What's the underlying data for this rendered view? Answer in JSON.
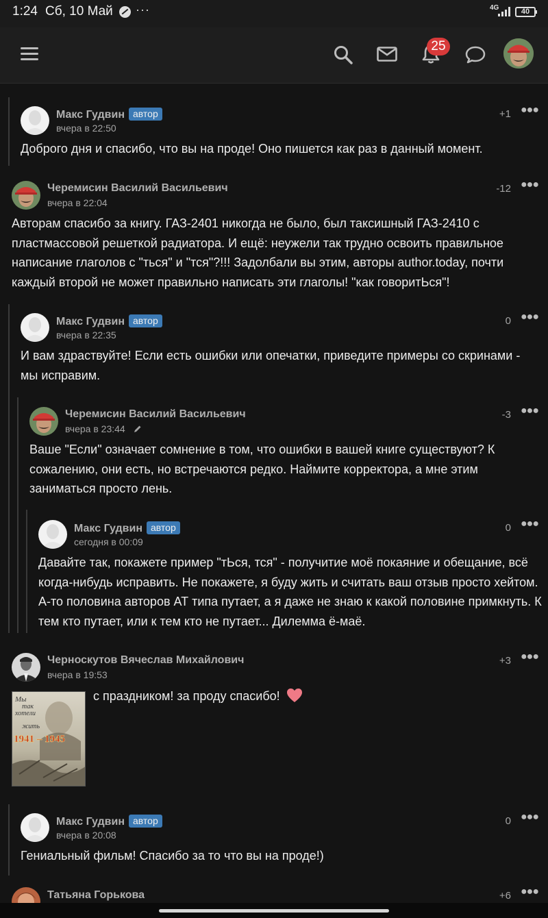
{
  "status_bar": {
    "time": "1:24",
    "date": "Сб, 10 Май",
    "network": "4G",
    "battery": "40"
  },
  "nav": {
    "icons": [
      "menu-icon",
      "search-icon",
      "mail-icon",
      "bell-icon",
      "chat-icon"
    ],
    "notification_count": "25"
  },
  "author_badge": "автор",
  "comments": [
    {
      "author": "Макс Гудвин",
      "is_author": true,
      "time": "вчера в 22:50",
      "score": "+1",
      "text": "Доброго дня и спасибо, что вы на проде! Оно пишется как раз в данный момент."
    },
    {
      "author": "Черемисин Василий Васильевич",
      "is_author": false,
      "time": "вчера в 22:04",
      "score": "-12",
      "text": "Авторам спасибо за книгу. ГАЗ-2401 никогда не было, был таксишный ГАЗ-2410 с пластмассовой решеткой радиатора. И ещё: неужели так трудно освоить правильное написание глаголов с \"ться\" и \"тся\"?!!! Задолбали вы этим, авторы author.today, почти каждый второй не может правильно написать эти глаголы! \"как говоритЬся\"!"
    },
    {
      "author": "Макс Гудвин",
      "is_author": true,
      "time": "вчера в 22:35",
      "score": "0",
      "text": "И вам здраствуйте! Если есть ошибки или опечатки, приведите примеры со скринами - мы исправим."
    },
    {
      "author": "Черемисин Василий Васильевич",
      "is_author": false,
      "time": "вчера в 23:44",
      "score": "-3",
      "edited": true,
      "text": "Ваше \"Если\" означает сомнение в том, что ошибки в вашей книге существуют? К сожалению, они есть, но встречаются редко. Наймите корректора, а мне этим заниматься просто лень."
    },
    {
      "author": "Макс Гудвин",
      "is_author": true,
      "time": "сегодня в 00:09",
      "score": "0",
      "text": "Давайте так, покажете пример \"тЬся, тся\" - получитие моё покаяние и обещание, всё когда-нибудь исправить. Не покажете, я буду жить и считать ваш отзыв просто хейтом. А-то половина авторов АТ типа путает, а я даже не знаю к какой половине примкнуть. К тем кто путает, или к тем кто не путает... Дилемма ё-маё."
    },
    {
      "author": "Черноскутов Вячеслав Михайлович",
      "is_author": false,
      "time": "вчера в 19:53",
      "score": "+3",
      "text": "с праздником! за проду спасибо!",
      "image": {
        "line1": "Мы",
        "line2": "так",
        "line3": "хотели",
        "line4": "жить",
        "years": "1941 – 1945"
      }
    },
    {
      "author": "Макс Гудвин",
      "is_author": true,
      "time": "вчера в 20:08",
      "score": "0",
      "text": "Гениальный фильм! Спасибо за то что вы на проде!)"
    },
    {
      "author": "Татьяна Горькова",
      "is_author": false,
      "time": "",
      "score": "+6",
      "text": ""
    }
  ]
}
